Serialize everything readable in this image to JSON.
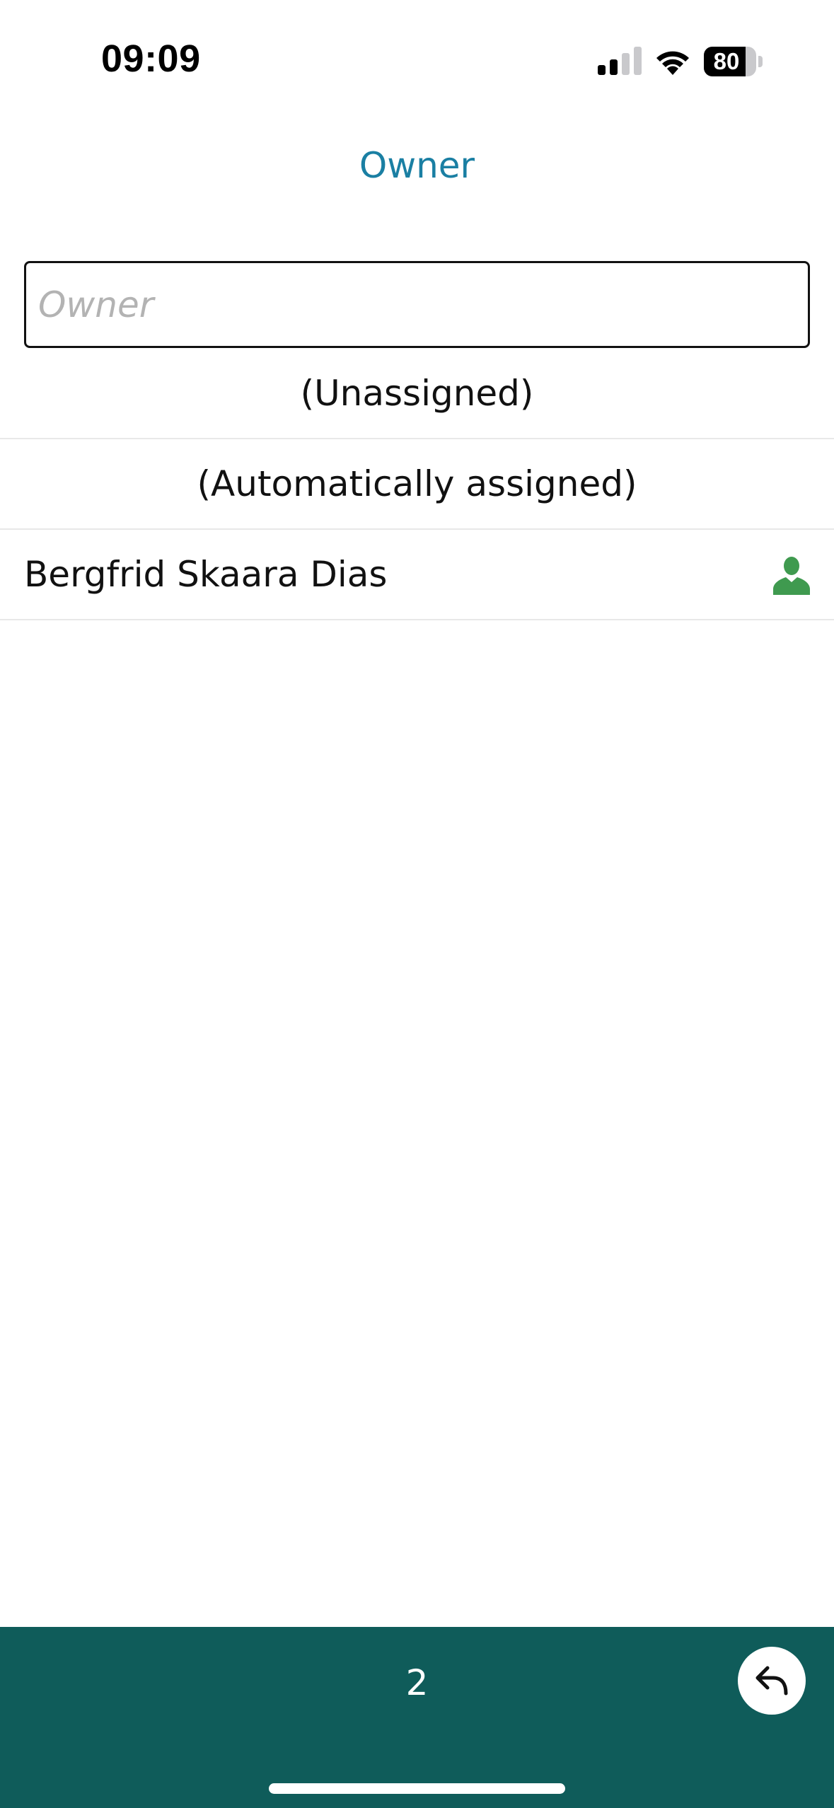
{
  "status_bar": {
    "time": "09:09",
    "battery_level": "80",
    "battery_fraction": 0.8
  },
  "header": {
    "title": "Owner"
  },
  "search": {
    "placeholder": "Owner",
    "value": ""
  },
  "owner_list": {
    "items": [
      {
        "label": "(Unassigned)",
        "align": "center",
        "icon": null
      },
      {
        "label": "(Automatically assigned)",
        "align": "center",
        "icon": null
      },
      {
        "label": "Bergfrid Skaara Dias",
        "align": "left",
        "icon": "user-icon"
      }
    ]
  },
  "bottom_bar": {
    "page_number": "2",
    "back_icon": "undo-arrow-icon"
  },
  "colors": {
    "title": "#1a7fa3",
    "bottom_bar": "#0f5c5a",
    "user_icon": "#3f9a4f"
  }
}
